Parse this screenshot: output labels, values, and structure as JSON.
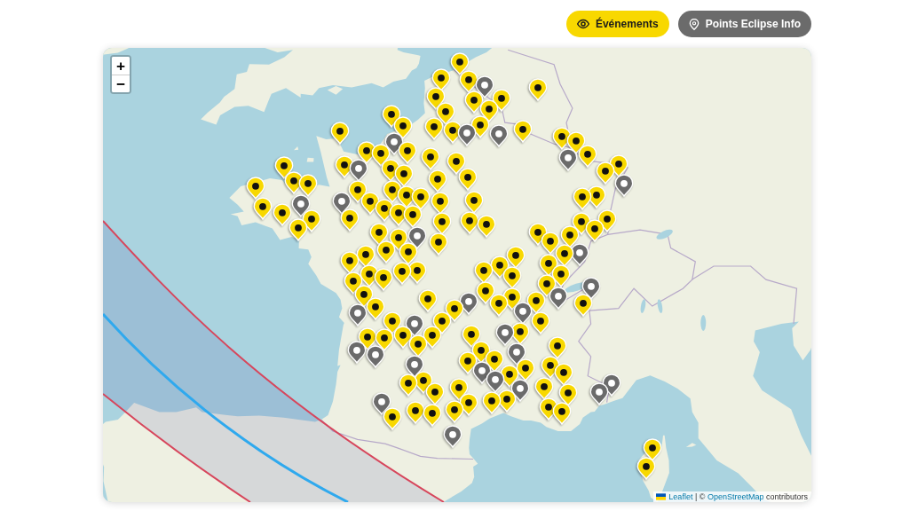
{
  "layers": [
    {
      "kind": "events",
      "label": "Événements",
      "color": "#f8d800"
    },
    {
      "kind": "points",
      "label": "Points Eclipse Info",
      "color": "#6b6b6b"
    }
  ],
  "map": {
    "zoom_controls": [
      {
        "label": "+"
      },
      {
        "label": "−"
      }
    ],
    "attribution": [
      {
        "kind": "link",
        "text": "Leaflet"
      },
      {
        "kind": "text",
        "text": "| ©"
      },
      {
        "kind": "link",
        "text": "OpenStreetMap"
      },
      {
        "kind": "text",
        "text": "contributors"
      }
    ]
  }
}
